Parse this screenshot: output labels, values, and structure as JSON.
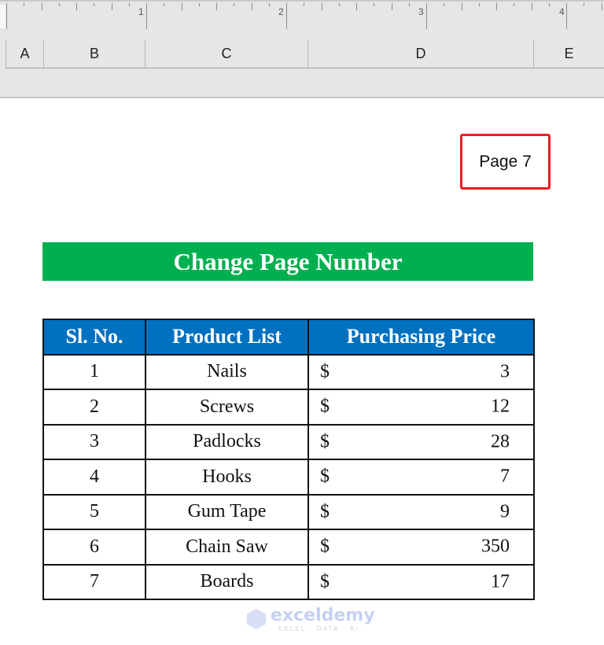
{
  "ruler": {
    "numbers": [
      "1",
      "2",
      "3",
      "4"
    ]
  },
  "column_headers": [
    "A",
    "B",
    "C",
    "D",
    "E"
  ],
  "page_header": {
    "text": "Page 7",
    "highlight_color": "#ee1c24"
  },
  "title": {
    "text": "Change Page Number",
    "background_color": "#00b050"
  },
  "table": {
    "header_color": "#0070c0",
    "headers": [
      "Sl. No.",
      "Product List",
      "Purchasing Price"
    ],
    "currency_symbol": "$",
    "rows": [
      {
        "sl": "1",
        "product": "Nails",
        "price": "3"
      },
      {
        "sl": "2",
        "product": "Screws",
        "price": "12"
      },
      {
        "sl": "3",
        "product": "Padlocks",
        "price": "28"
      },
      {
        "sl": "4",
        "product": "Hooks",
        "price": "7"
      },
      {
        "sl": "5",
        "product": "Gum Tape",
        "price": "9"
      },
      {
        "sl": "6",
        "product": "Chain Saw",
        "price": "350"
      },
      {
        "sl": "7",
        "product": "Boards",
        "price": "17"
      }
    ]
  },
  "watermark": {
    "brand": "exceldemy",
    "tagline": "EXCEL · DATA · BI"
  }
}
